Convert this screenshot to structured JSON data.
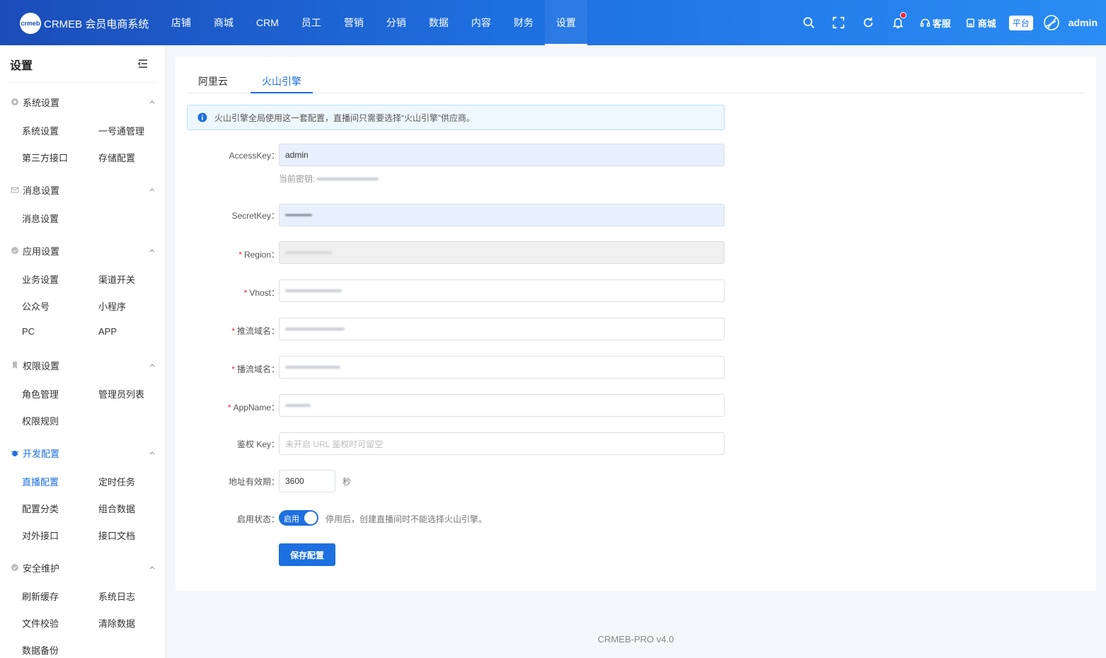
{
  "header": {
    "logo_mark": "crmeb",
    "logo_text": "CRMEB 会员电商系统",
    "nav": [
      "店铺",
      "商城",
      "CRM",
      "员工",
      "营销",
      "分销",
      "数据",
      "内容",
      "财务",
      "设置"
    ],
    "active_nav": "设置",
    "service_label": "客服",
    "mall_label": "商城",
    "platform_badge": "平台",
    "username": "admin"
  },
  "sidebar": {
    "title": "设置",
    "groups": [
      {
        "label": "系统设置",
        "icon": "gear-icon",
        "items": [
          "系统设置",
          "一号通管理",
          "第三方接口",
          "存储配置"
        ]
      },
      {
        "label": "消息设置",
        "icon": "envelope-icon",
        "items": [
          "消息设置"
        ]
      },
      {
        "label": "应用设置",
        "icon": "app-icon",
        "items": [
          "业务设置",
          "渠道开关",
          "公众号",
          "小程序",
          "PC",
          "APP"
        ]
      },
      {
        "label": "权限设置",
        "icon": "bookmark-icon",
        "items": [
          "角色管理",
          "管理员列表",
          "权限规则"
        ]
      },
      {
        "label": "开发配置",
        "icon": "bug-icon",
        "items": [
          "直播配置",
          "定时任务",
          "配置分类",
          "组合数据",
          "对外接口",
          "接口文档"
        ]
      },
      {
        "label": "安全维护",
        "icon": "shield-check-icon",
        "items": [
          "刷新缓存",
          "系统日志",
          "文件校验",
          "清除数据",
          "数据备份"
        ]
      }
    ],
    "active_item": "直播配置"
  },
  "tabs": [
    "阿里云",
    "火山引擎"
  ],
  "active_tab": "火山引擎",
  "alert": "火山引擎全局使用这一套配置，直播间只需要选择“火山引擎”供应商。",
  "form": {
    "access_key_label": "AccessKey：",
    "access_key_value": "admin",
    "current_secret_label": "当前密钥:",
    "secret_key_label": "SecretKey：",
    "region_label": "Region：",
    "vhost_label": "Vhost：",
    "push_domain_label": "推流域名：",
    "play_domain_label": "播流域名：",
    "app_name_label": "AppName：",
    "auth_key_label": "鉴权 Key：",
    "auth_key_placeholder": "未开启 URL 鉴权时可留空",
    "expire_label": "地址有效期：",
    "expire_value": "3600",
    "expire_unit": "秒",
    "status_label": "启用状态：",
    "status_on_text": "启用",
    "status_desc": "停用后，创建直播间时不能选择火山引擎。",
    "save_button": "保存配置"
  },
  "footer": "CRMEB-PRO v4.0",
  "colors": {
    "primary": "#1e6fe0",
    "header_start": "#1b4db8",
    "header_end": "#2a8cf5",
    "required": "#f5222d"
  }
}
